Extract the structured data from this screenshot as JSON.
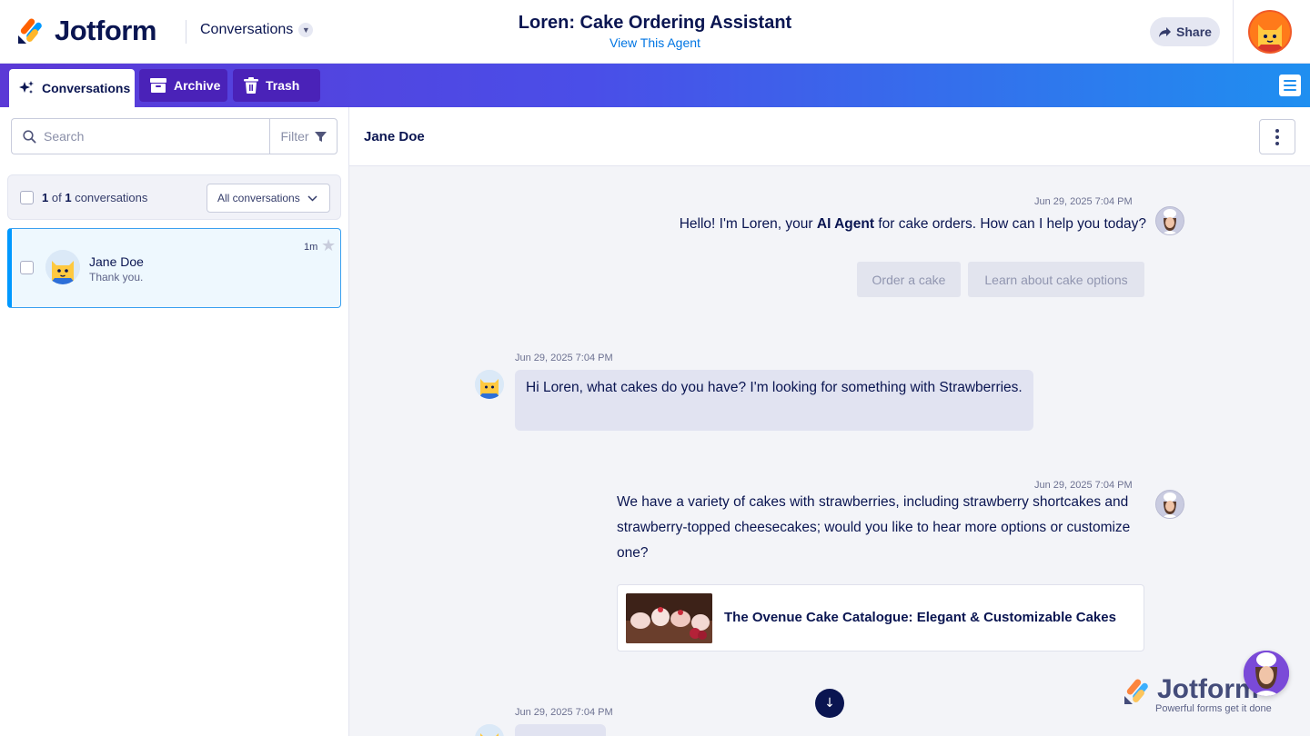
{
  "header": {
    "logo_text": "Jotform",
    "section_label": "Conversations",
    "title": "Loren: Cake Ordering Assistant",
    "view_link": "View This Agent",
    "share_label": "Share"
  },
  "tabs": [
    {
      "label": "Conversations",
      "icon": "sparkle-icon",
      "active": true
    },
    {
      "label": "Archive",
      "icon": "archive-icon",
      "active": false
    },
    {
      "label": "Trash",
      "icon": "trash-icon",
      "active": false
    }
  ],
  "sidebar": {
    "search_placeholder": "Search",
    "filter_label": "Filter",
    "count_current": "1",
    "count_of": "of",
    "count_total": "1",
    "count_suffix": "conversations",
    "dropdown_label": "All conversations",
    "conversations": [
      {
        "name": "Jane Doe",
        "preview": "Thank you.",
        "time": "1m",
        "selected": true
      }
    ]
  },
  "chat": {
    "contact_name": "Jane Doe",
    "messages": [
      {
        "sender": "agent",
        "timestamp": "Jun 29, 2025 7:04 PM",
        "text_pre": "Hello! I'm Loren, your ",
        "text_bold": "AI Agent",
        "text_post": " for cake orders. How can I help you today?"
      },
      {
        "sender": "user",
        "timestamp": "Jun 29, 2025 7:04 PM",
        "text": "Hi Loren, what cakes do you have? I'm looking for something with Strawberries."
      },
      {
        "sender": "agent",
        "timestamp": "Jun 29, 2025 7:04 PM",
        "text": "We have a variety of cakes with strawberries, including strawberry shortcakes and strawberry-topped cheesecakes; would you like to hear more options or customize one?"
      },
      {
        "sender": "user",
        "timestamp": "Jun 29, 2025 7:04 PM",
        "text": ""
      }
    ],
    "quick_replies": [
      "Order a cake",
      "Learn about cake options"
    ],
    "card_title": "The Ovenue Cake Catalogue: Elegant & Customizable Cakes"
  },
  "branding": {
    "name": "Jotform",
    "tagline": "Powerful forms get it done"
  },
  "colors": {
    "brand_navy": "#0a1551",
    "link_blue": "#0075e3",
    "tab_gradient_start": "#5b39d6",
    "tab_gradient_end": "#1f8ff0",
    "selected_border": "#0099ff"
  }
}
